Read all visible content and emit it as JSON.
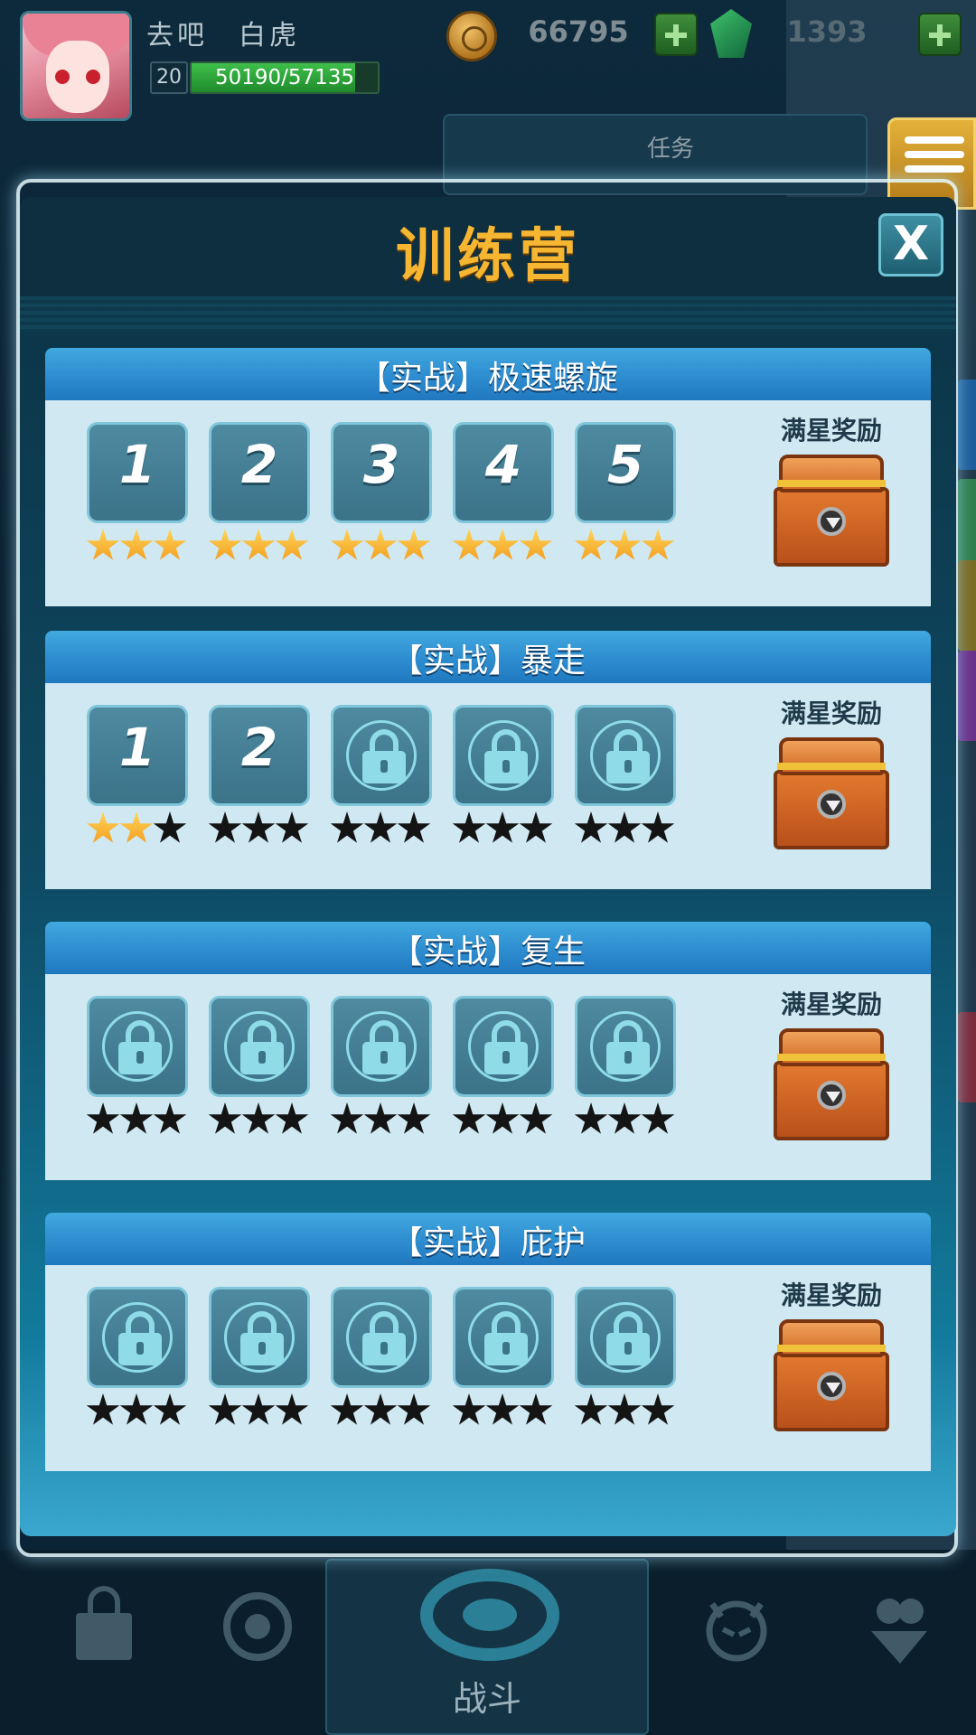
{
  "hud": {
    "player_name": "去吧　白虎",
    "level": "20",
    "exp_text": "50190/57135",
    "exp_progress": 0.878,
    "gold": "66795",
    "gems": "1393",
    "task_label": "任务"
  },
  "modal": {
    "title": "训练营",
    "close_label": "X",
    "reward_label": "满星奖励",
    "sections": [
      {
        "title": "【实战】极速螺旋",
        "stages": [
          {
            "label": "1",
            "locked": false,
            "stars": 3
          },
          {
            "label": "2",
            "locked": false,
            "stars": 3
          },
          {
            "label": "3",
            "locked": false,
            "stars": 3
          },
          {
            "label": "4",
            "locked": false,
            "stars": 3
          },
          {
            "label": "5",
            "locked": false,
            "stars": 3
          }
        ]
      },
      {
        "title": "【实战】暴走",
        "stages": [
          {
            "label": "1",
            "locked": false,
            "stars": 2
          },
          {
            "label": "2",
            "locked": false,
            "stars": 0
          },
          {
            "label": "",
            "locked": true,
            "stars": 0
          },
          {
            "label": "",
            "locked": true,
            "stars": 0
          },
          {
            "label": "",
            "locked": true,
            "stars": 0
          }
        ]
      },
      {
        "title": "【实战】复生",
        "stages": [
          {
            "label": "",
            "locked": true,
            "stars": 0
          },
          {
            "label": "",
            "locked": true,
            "stars": 0
          },
          {
            "label": "",
            "locked": true,
            "stars": 0
          },
          {
            "label": "",
            "locked": true,
            "stars": 0
          },
          {
            "label": "",
            "locked": true,
            "stars": 0
          }
        ]
      },
      {
        "title": "【实战】庇护",
        "stages": [
          {
            "label": "",
            "locked": true,
            "stars": 0
          },
          {
            "label": "",
            "locked": true,
            "stars": 0
          },
          {
            "label": "",
            "locked": true,
            "stars": 0
          },
          {
            "label": "",
            "locked": true,
            "stars": 0
          },
          {
            "label": "",
            "locked": true,
            "stars": 0
          }
        ]
      }
    ]
  },
  "bottom_nav": {
    "battle_label": "战斗"
  },
  "colors": {
    "title_gold": "#f6b631",
    "section_blue": "#2f8fd1",
    "star_on": "#f29b1b",
    "star_off": "#141414"
  }
}
